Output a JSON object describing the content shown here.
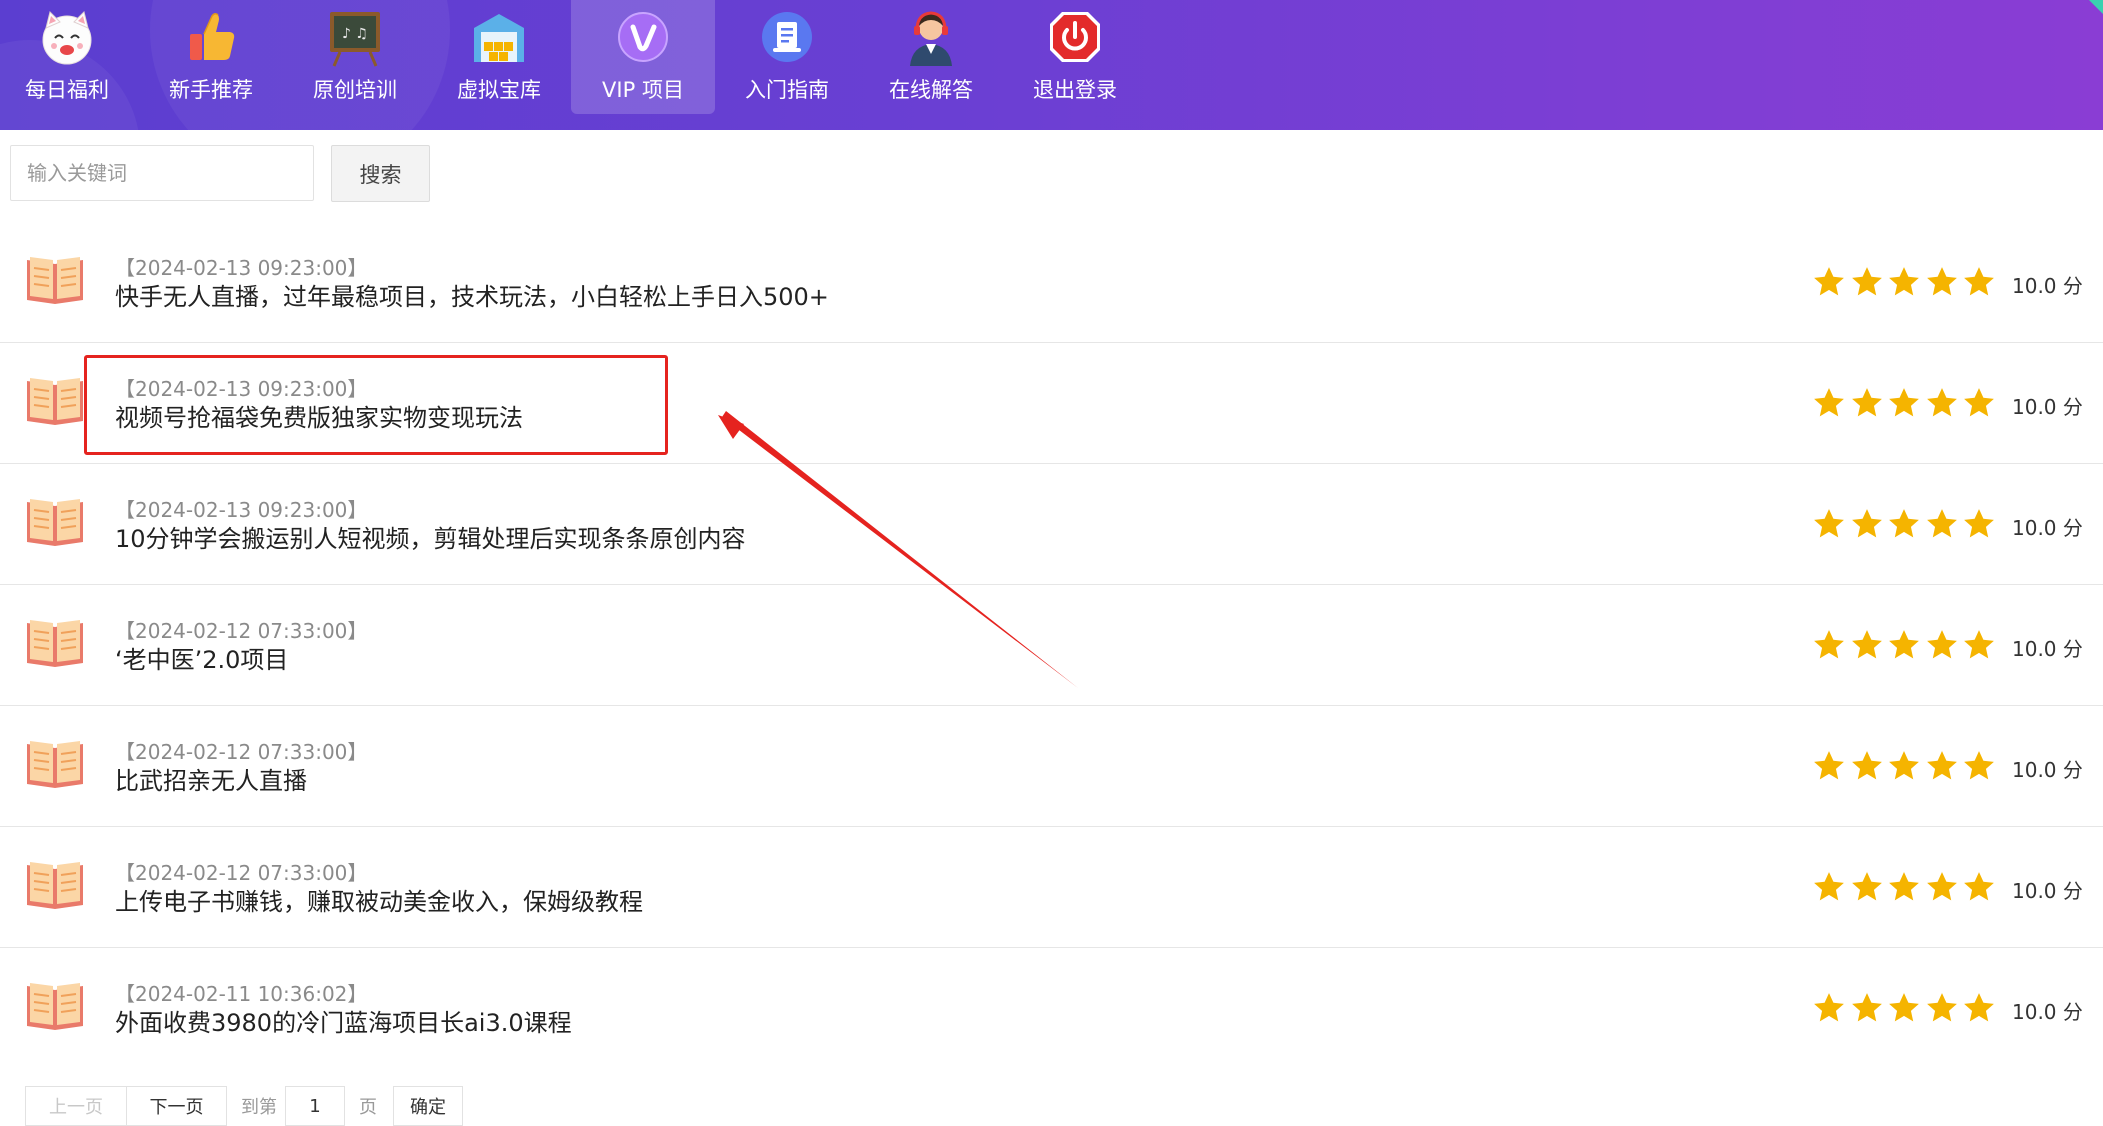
{
  "nav": {
    "items": [
      {
        "label": "每日福利",
        "icon": "lucky-cat-icon"
      },
      {
        "label": "新手推荐",
        "icon": "thumbs-up-icon"
      },
      {
        "label": "原创培训",
        "icon": "chalkboard-icon"
      },
      {
        "label": "虚拟宝库",
        "icon": "warehouse-icon"
      },
      {
        "label": "VIP 项目",
        "icon": "vip-icon",
        "active": true
      },
      {
        "label": "入门指南",
        "icon": "document-icon"
      },
      {
        "label": "在线解答",
        "icon": "support-agent-icon"
      },
      {
        "label": "退出登录",
        "icon": "power-icon"
      }
    ]
  },
  "search": {
    "placeholder": "输入关键词",
    "button_label": "搜索"
  },
  "list": {
    "items": [
      {
        "date": "【2024-02-13 09:23:00】",
        "title": "快手无人直播，过年最稳项目，技术玩法，小白轻松上手日入500+",
        "rating": 5,
        "score": "10.0 分"
      },
      {
        "date": "【2024-02-13 09:23:00】",
        "title": "视频号抢福袋免费版独家实物变现玩法",
        "rating": 5,
        "score": "10.0 分"
      },
      {
        "date": "【2024-02-13 09:23:00】",
        "title": "10分钟学会搬运别人短视频，剪辑处理后实现条条原创内容",
        "rating": 5,
        "score": "10.0 分"
      },
      {
        "date": "【2024-02-12 07:33:00】",
        "title": "‘老中医’2.0项目",
        "rating": 5,
        "score": "10.0 分"
      },
      {
        "date": "【2024-02-12 07:33:00】",
        "title": "比武招亲无人直播",
        "rating": 5,
        "score": "10.0 分"
      },
      {
        "date": "【2024-02-12 07:33:00】",
        "title": "上传电子书赚钱，赚取被动美金收入，保姆级教程",
        "rating": 5,
        "score": "10.0 分"
      },
      {
        "date": "【2024-02-11 10:36:02】",
        "title": "外面收费3980的冷门蓝海项目长ai3.0课程",
        "rating": 5,
        "score": "10.0 分"
      }
    ]
  },
  "pager": {
    "prev_label": "上一页",
    "next_label": "下一页",
    "goto_label": "到第",
    "page_value": "1",
    "unit_label": "页",
    "confirm_label": "确定"
  },
  "colors": {
    "nav_gradient_start": "#5b3ed0",
    "nav_gradient_end": "#8a3dd4",
    "star": "#f5b400",
    "annotation": "#e5231f"
  }
}
